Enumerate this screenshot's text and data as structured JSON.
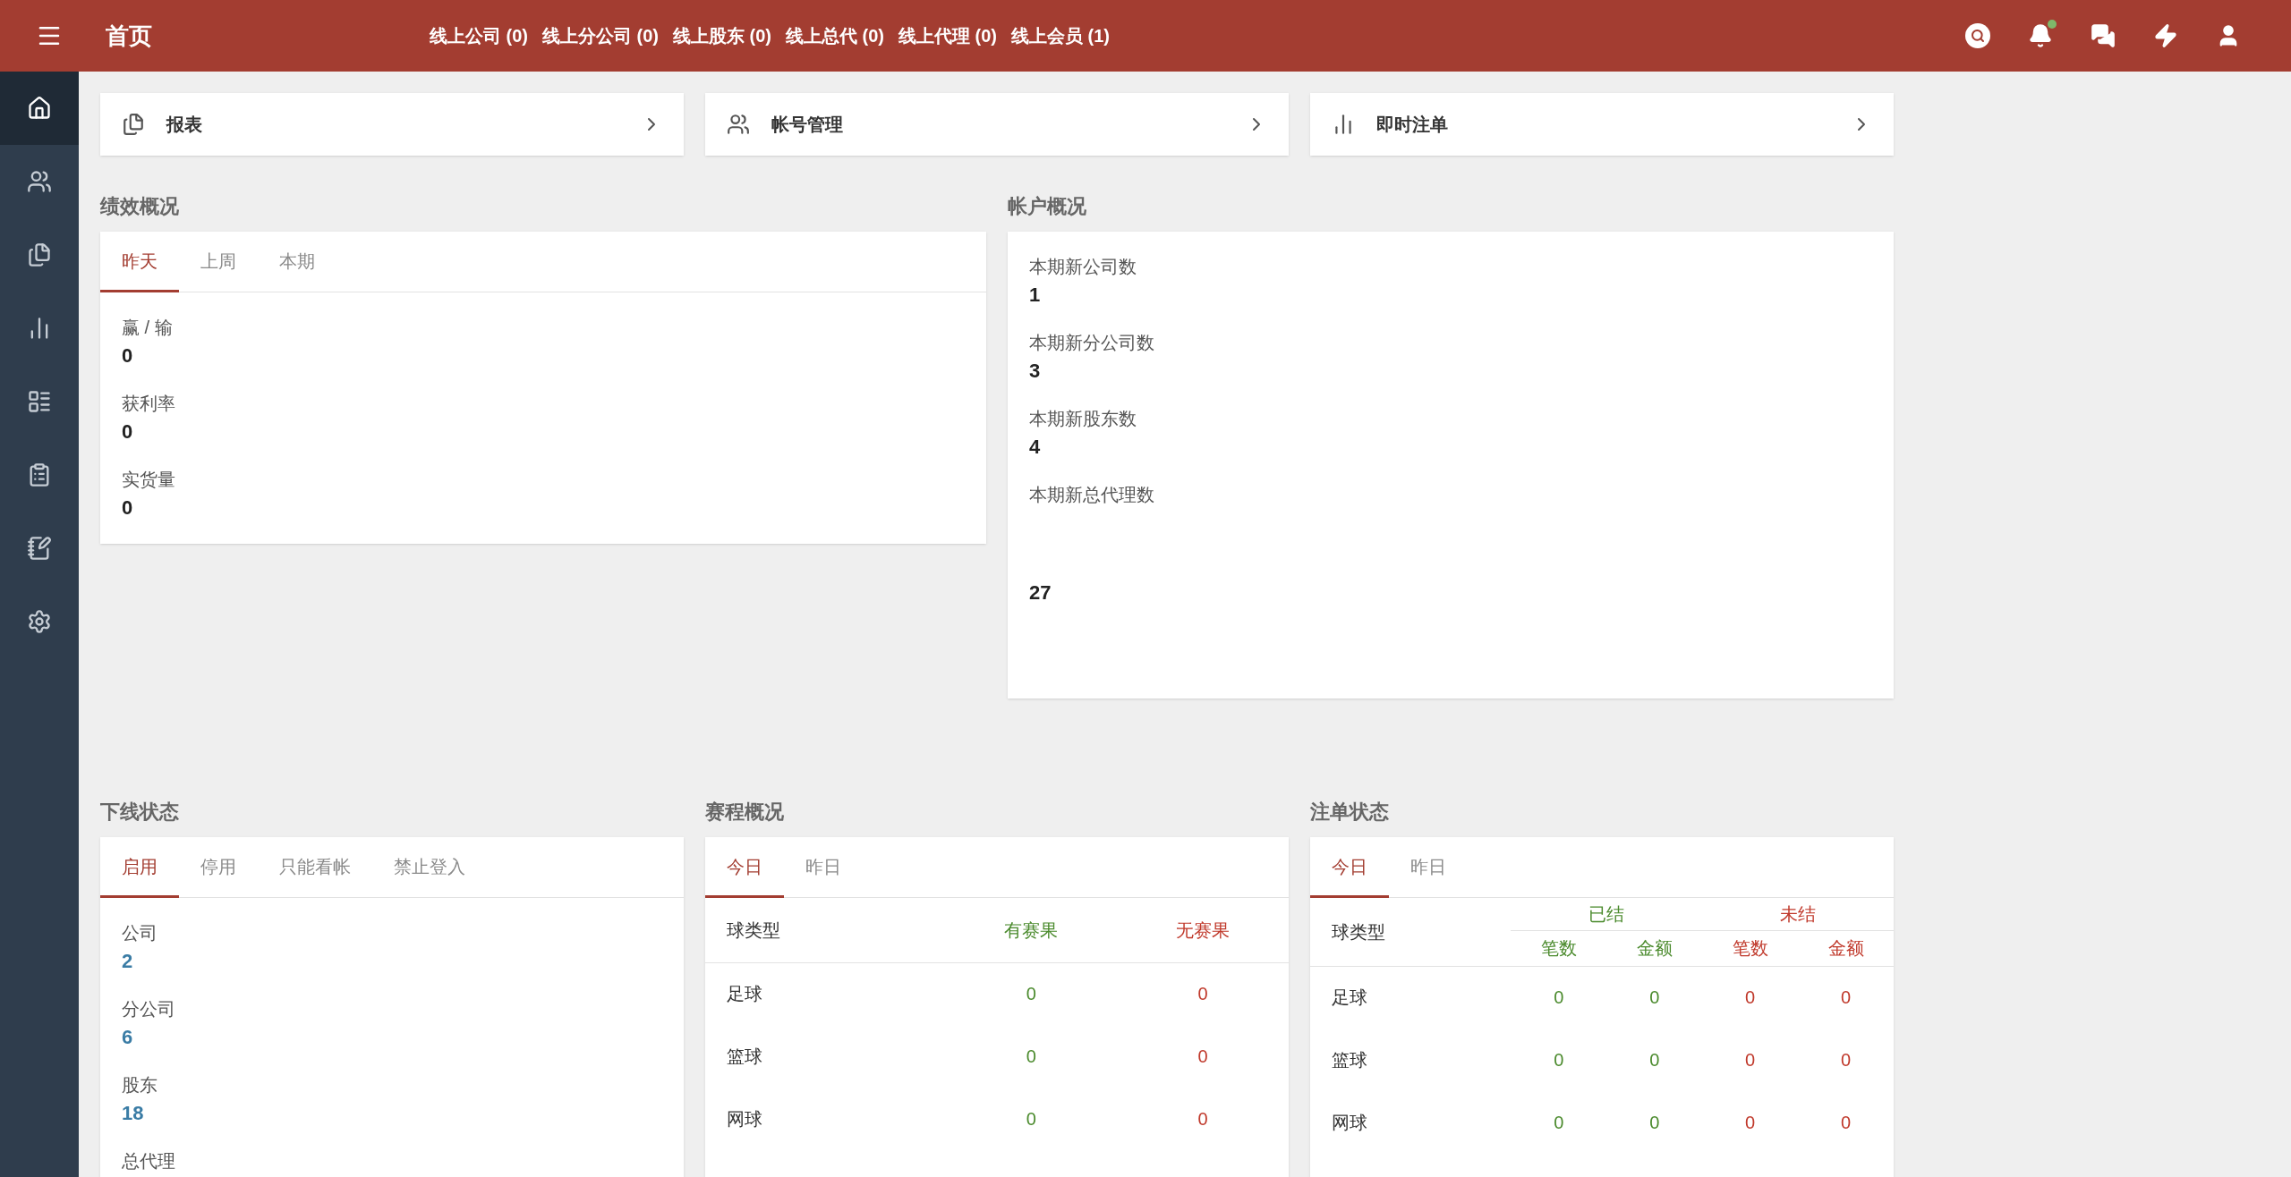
{
  "header": {
    "title": "首页",
    "links": [
      "线上公司 (0)",
      "线上分公司 (0)",
      "线上股东 (0)",
      "线上总代 (0)",
      "线上代理 (0)",
      "线上会员 (1)"
    ],
    "notification_dot": true
  },
  "sidebar": {
    "items": [
      {
        "selected": true
      },
      {
        "selected": false
      },
      {
        "selected": false
      },
      {
        "selected": false
      },
      {
        "selected": false
      },
      {
        "selected": false
      },
      {
        "selected": false
      },
      {
        "selected": false
      }
    ]
  },
  "quick_links": [
    {
      "label": "报表"
    },
    {
      "label": "帐号管理"
    },
    {
      "label": "即时注单"
    }
  ],
  "performance": {
    "title": "绩效概况",
    "tabs": [
      {
        "label": "昨天",
        "selected": true
      },
      {
        "label": "上周",
        "selected": false
      },
      {
        "label": "本期",
        "selected": false
      }
    ],
    "items": [
      {
        "label": "赢 / 输",
        "value": "0"
      },
      {
        "label": "获利率",
        "value": "0"
      },
      {
        "label": "实货量",
        "value": "0"
      }
    ]
  },
  "accounts": {
    "title": "帐户概况",
    "items": [
      {
        "label": "本期新公司数",
        "value": "1"
      },
      {
        "label": "本期新分公司数",
        "value": "3"
      },
      {
        "label": "本期新股东数",
        "value": "4"
      },
      {
        "label": "本期新总代理数"
      },
      {
        "value": "27"
      }
    ]
  },
  "downline": {
    "title": "下线状态",
    "tabs": [
      {
        "label": "启用",
        "selected": true
      },
      {
        "label": "停用",
        "selected": false
      },
      {
        "label": "只能看帐",
        "selected": false
      },
      {
        "label": "禁止登入",
        "selected": false
      }
    ],
    "items": [
      {
        "label": "公司",
        "value": "2"
      },
      {
        "label": "分公司",
        "value": "6"
      },
      {
        "label": "股东",
        "value": "18"
      },
      {
        "label": "总代理"
      }
    ]
  },
  "schedule": {
    "title": "赛程概况",
    "tabs": [
      {
        "label": "今日",
        "selected": true
      },
      {
        "label": "昨日",
        "selected": false
      }
    ],
    "columns": [
      "球类型",
      "有赛果",
      "无赛果"
    ],
    "rows": [
      [
        "足球",
        "0",
        "0"
      ],
      [
        "篮球",
        "0",
        "0"
      ],
      [
        "网球",
        "0",
        "0"
      ]
    ]
  },
  "bets": {
    "title": "注单状态",
    "tabs": [
      {
        "label": "今日",
        "selected": true
      },
      {
        "label": "昨日",
        "selected": false
      }
    ],
    "type_column": "球类型",
    "groups": [
      {
        "label": "已结",
        "kind": "settled",
        "columns": [
          "笔数",
          "金额"
        ]
      },
      {
        "label": "未结",
        "kind": "unsettled",
        "columns": [
          "笔数",
          "金额"
        ]
      }
    ],
    "rows": [
      [
        "足球",
        "0",
        "0",
        "0",
        "0"
      ],
      [
        "篮球",
        "0",
        "0",
        "0",
        "0"
      ],
      [
        "网球",
        "0",
        "0",
        "0",
        "0"
      ]
    ]
  }
}
